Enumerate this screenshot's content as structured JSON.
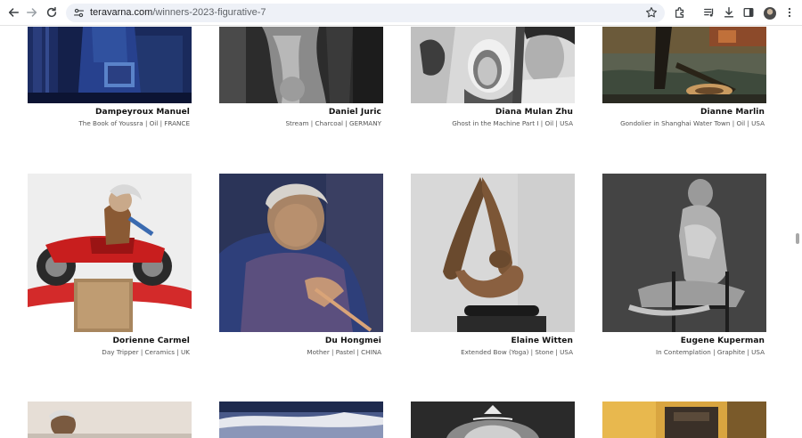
{
  "browser": {
    "url_host": "teravarna.com",
    "url_path": "/winners-2023-figurative-7"
  },
  "gallery": {
    "row1": [
      {
        "artist": "Dampeyroux Manuel",
        "caption": "The Book of Youssra | Oil | FRANCE"
      },
      {
        "artist": "Daniel Juric",
        "caption": "Stream | Charcoal | GERMANY"
      },
      {
        "artist": "Diana Mulan Zhu",
        "caption": "Ghost in the Machine Part I | Oil | USA"
      },
      {
        "artist": "Dianne Marlin",
        "caption": "Gondolier in Shanghai Water Town | Oil | USA"
      }
    ],
    "row2": [
      {
        "artist": "Dorienne Carmel",
        "caption": "Day Tripper | Ceramics | UK"
      },
      {
        "artist": "Du Hongmei",
        "caption": "Mother | Pastel | CHINA"
      },
      {
        "artist": "Elaine Witten",
        "caption": "Extended Bow (Yoga) | Stone | USA"
      },
      {
        "artist": "Eugene Kuperman",
        "caption": "In Contemplation | Graphite | USA"
      }
    ]
  }
}
